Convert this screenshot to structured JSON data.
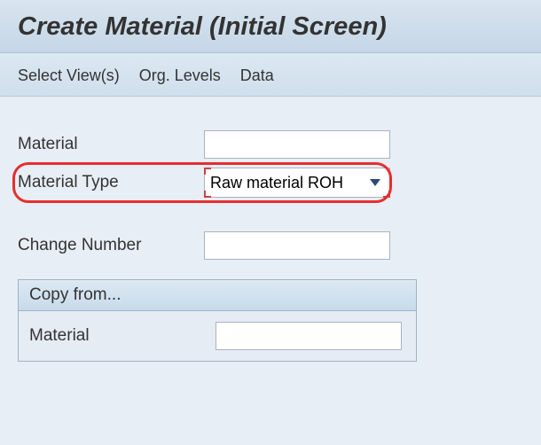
{
  "title": "Create Material (Initial Screen)",
  "menu": {
    "select_views": "Select View(s)",
    "org_levels": "Org. Levels",
    "data": "Data"
  },
  "form": {
    "material_label": "Material",
    "material_value": "",
    "material_type_label": "Material Type",
    "material_type_value": "Raw material ROH",
    "change_number_label": "Change Number",
    "change_number_value": ""
  },
  "copy_from": {
    "header": "Copy from...",
    "material_label": "Material",
    "material_value": ""
  }
}
